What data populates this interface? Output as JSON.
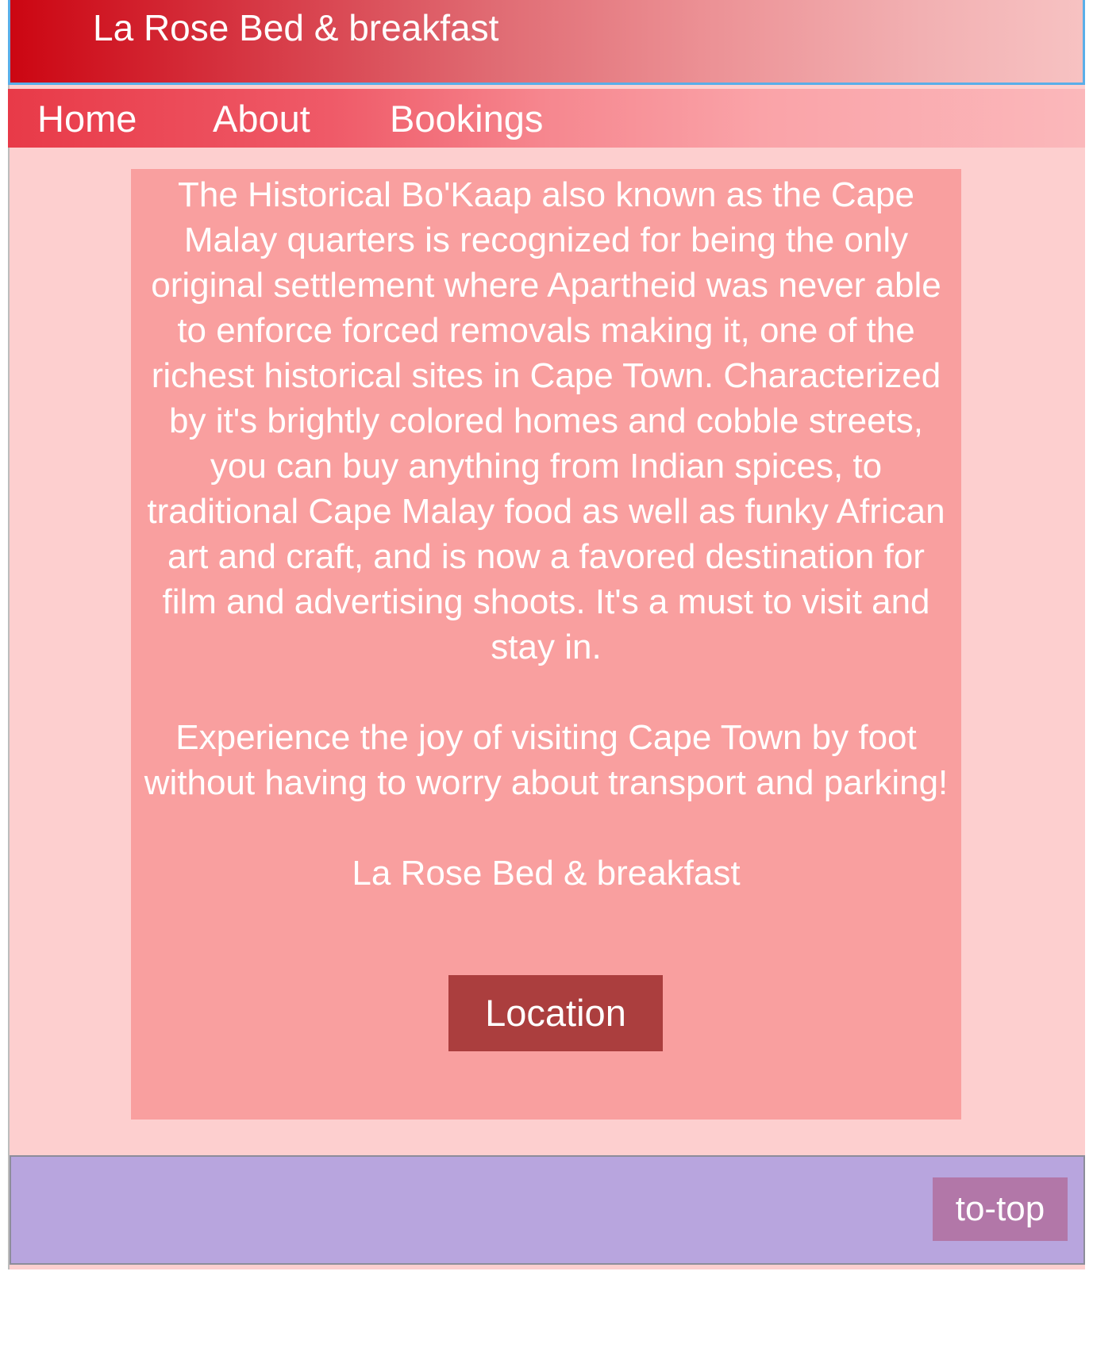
{
  "header": {
    "title": "La Rose Bed & breakfast"
  },
  "nav": {
    "items": [
      {
        "label": "Home"
      },
      {
        "label": "About"
      },
      {
        "label": "Bookings"
      }
    ]
  },
  "main": {
    "paragraph1": "The Historical Bo'Kaap also known as the Cape Malay quarters is recognized for being the only original settlement where Apartheid was never able to enforce forced removals making it, one of the richest historical sites in Cape Town. Characterized by it's brightly colored homes and cobble streets, you can buy anything from Indian spices, to traditional Cape Malay food as well as funky African art and craft, and is now a favored destination for film and advertising shoots. It's a must to visit and stay in.",
    "paragraph2": "Experience the joy of visiting Cape Town by foot without having to worry about transport and parking!",
    "brand_line": "La Rose Bed & breakfast",
    "location_label": "Location"
  },
  "footer": {
    "to_top_label": "to-top"
  },
  "colors": {
    "page_bg": "#fdcfcf",
    "content_bg": "#f99f9f",
    "location_button": "#ab3e3e",
    "footer_bg": "#b8a5de",
    "to_top_button": "#b277a8",
    "header_border": "#5aaee8"
  }
}
